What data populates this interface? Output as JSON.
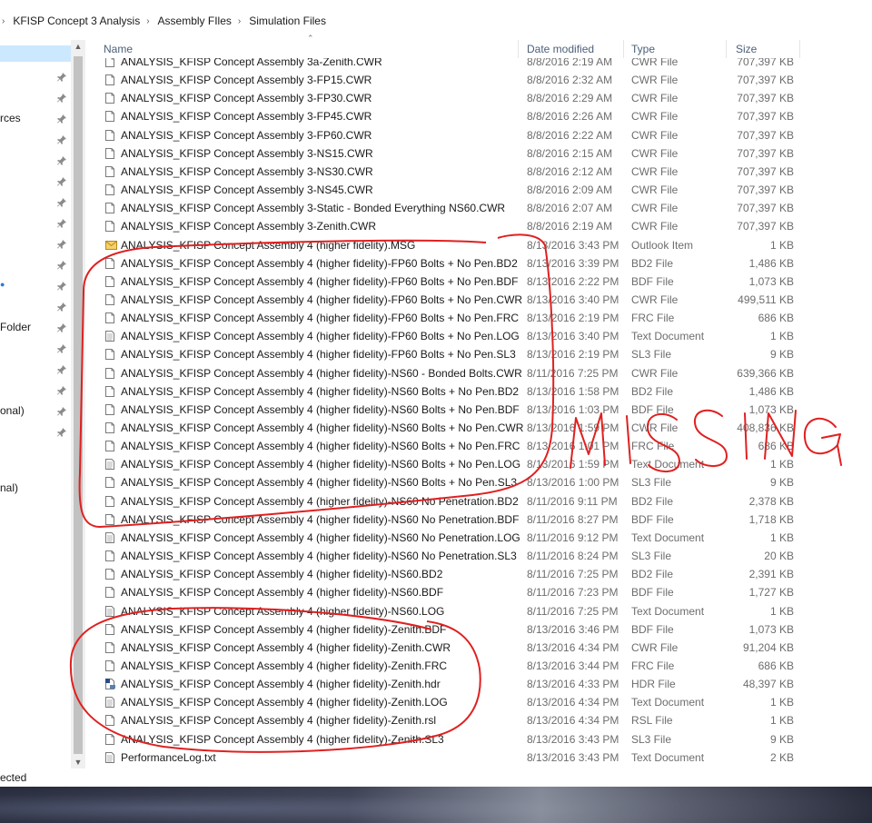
{
  "breadcrumb": [
    "KFISP Concept 3 Analysis",
    "Assembly FIles",
    "Simulation Files"
  ],
  "nav": {
    "labels": [
      "rces",
      "Folder",
      "onal)",
      "nal)"
    ]
  },
  "columns": {
    "name": "Name",
    "date": "Date modified",
    "type": "Type",
    "size": "Size"
  },
  "files": [
    {
      "name": "ANALYSIS_KFISP Concept Assembly 3a-Zenith.CWR",
      "date": "8/8/2016 2:19 AM",
      "type": "CWR File",
      "size": "707,397 KB",
      "icon": "file-icon"
    },
    {
      "name": "ANALYSIS_KFISP Concept Assembly 3-FP15.CWR",
      "date": "8/8/2016 2:32 AM",
      "type": "CWR File",
      "size": "707,397 KB",
      "icon": "file-icon"
    },
    {
      "name": "ANALYSIS_KFISP Concept Assembly 3-FP30.CWR",
      "date": "8/8/2016 2:29 AM",
      "type": "CWR File",
      "size": "707,397 KB",
      "icon": "file-icon"
    },
    {
      "name": "ANALYSIS_KFISP Concept Assembly 3-FP45.CWR",
      "date": "8/8/2016 2:26 AM",
      "type": "CWR File",
      "size": "707,397 KB",
      "icon": "file-icon"
    },
    {
      "name": "ANALYSIS_KFISP Concept Assembly 3-FP60.CWR",
      "date": "8/8/2016 2:22 AM",
      "type": "CWR File",
      "size": "707,397 KB",
      "icon": "file-icon"
    },
    {
      "name": "ANALYSIS_KFISP Concept Assembly 3-NS15.CWR",
      "date": "8/8/2016 2:15 AM",
      "type": "CWR File",
      "size": "707,397 KB",
      "icon": "file-icon"
    },
    {
      "name": "ANALYSIS_KFISP Concept Assembly 3-NS30.CWR",
      "date": "8/8/2016 2:12 AM",
      "type": "CWR File",
      "size": "707,397 KB",
      "icon": "file-icon"
    },
    {
      "name": "ANALYSIS_KFISP Concept Assembly 3-NS45.CWR",
      "date": "8/8/2016 2:09 AM",
      "type": "CWR File",
      "size": "707,397 KB",
      "icon": "file-icon"
    },
    {
      "name": "ANALYSIS_KFISP Concept Assembly 3-Static - Bonded Everything NS60.CWR",
      "date": "8/8/2016 2:07 AM",
      "type": "CWR File",
      "size": "707,397 KB",
      "icon": "file-icon"
    },
    {
      "name": "ANALYSIS_KFISP Concept Assembly 3-Zenith.CWR",
      "date": "8/8/2016 2:19 AM",
      "type": "CWR File",
      "size": "707,397 KB",
      "icon": "file-icon"
    },
    {
      "name": "ANALYSIS_KFISP Concept Assembly 4 (higher fidelity).MSG",
      "date": "8/13/2016 3:43 PM",
      "type": "Outlook Item",
      "size": "1 KB",
      "icon": "envelope-icon"
    },
    {
      "name": "ANALYSIS_KFISP Concept Assembly 4 (higher fidelity)-FP60 Bolts + No Pen.BD2",
      "date": "8/13/2016 3:39 PM",
      "type": "BD2 File",
      "size": "1,486 KB",
      "icon": "file-icon"
    },
    {
      "name": "ANALYSIS_KFISP Concept Assembly 4 (higher fidelity)-FP60 Bolts + No Pen.BDF",
      "date": "8/13/2016 2:22 PM",
      "type": "BDF File",
      "size": "1,073 KB",
      "icon": "file-icon"
    },
    {
      "name": "ANALYSIS_KFISP Concept Assembly 4 (higher fidelity)-FP60 Bolts + No Pen.CWR",
      "date": "8/13/2016 3:40 PM",
      "type": "CWR File",
      "size": "499,511 KB",
      "icon": "file-icon"
    },
    {
      "name": "ANALYSIS_KFISP Concept Assembly 4 (higher fidelity)-FP60 Bolts + No Pen.FRC",
      "date": "8/13/2016 2:19 PM",
      "type": "FRC File",
      "size": "686 KB",
      "icon": "file-icon"
    },
    {
      "name": "ANALYSIS_KFISP Concept Assembly 4 (higher fidelity)-FP60 Bolts + No Pen.LOG",
      "date": "8/13/2016 3:40 PM",
      "type": "Text Document",
      "size": "1 KB",
      "icon": "text-file-icon"
    },
    {
      "name": "ANALYSIS_KFISP Concept Assembly 4 (higher fidelity)-FP60 Bolts + No Pen.SL3",
      "date": "8/13/2016 2:19 PM",
      "type": "SL3 File",
      "size": "9 KB",
      "icon": "file-icon"
    },
    {
      "name": "ANALYSIS_KFISP Concept Assembly 4 (higher fidelity)-NS60 - Bonded Bolts.CWR",
      "date": "8/11/2016 7:25 PM",
      "type": "CWR File",
      "size": "639,366 KB",
      "icon": "file-icon"
    },
    {
      "name": "ANALYSIS_KFISP Concept Assembly 4 (higher fidelity)-NS60 Bolts + No Pen.BD2",
      "date": "8/13/2016 1:58 PM",
      "type": "BD2 File",
      "size": "1,486 KB",
      "icon": "file-icon"
    },
    {
      "name": "ANALYSIS_KFISP Concept Assembly 4 (higher fidelity)-NS60 Bolts + No Pen.BDF",
      "date": "8/13/2016 1:03 PM",
      "type": "BDF File",
      "size": "1,073 KB",
      "icon": "file-icon"
    },
    {
      "name": "ANALYSIS_KFISP Concept Assembly 4 (higher fidelity)-NS60 Bolts + No Pen.CWR",
      "date": "8/13/2016 1:59 PM",
      "type": "CWR File",
      "size": "408,836 KB",
      "icon": "file-icon"
    },
    {
      "name": "ANALYSIS_KFISP Concept Assembly 4 (higher fidelity)-NS60 Bolts + No Pen.FRC",
      "date": "8/13/2016 1:01 PM",
      "type": "FRC File",
      "size": "686 KB",
      "icon": "file-icon"
    },
    {
      "name": "ANALYSIS_KFISP Concept Assembly 4 (higher fidelity)-NS60 Bolts + No Pen.LOG",
      "date": "8/13/2016 1:59 PM",
      "type": "Text Document",
      "size": "1 KB",
      "icon": "text-file-icon"
    },
    {
      "name": "ANALYSIS_KFISP Concept Assembly 4 (higher fidelity)-NS60 Bolts + No Pen.SL3",
      "date": "8/13/2016 1:00 PM",
      "type": "SL3 File",
      "size": "9 KB",
      "icon": "file-icon"
    },
    {
      "name": "ANALYSIS_KFISP Concept Assembly 4 (higher fidelity)-NS60 No Penetration.BD2",
      "date": "8/11/2016 9:11 PM",
      "type": "BD2 File",
      "size": "2,378 KB",
      "icon": "file-icon"
    },
    {
      "name": "ANALYSIS_KFISP Concept Assembly 4 (higher fidelity)-NS60 No Penetration.BDF",
      "date": "8/11/2016 8:27 PM",
      "type": "BDF File",
      "size": "1,718 KB",
      "icon": "file-icon"
    },
    {
      "name": "ANALYSIS_KFISP Concept Assembly 4 (higher fidelity)-NS60 No Penetration.LOG",
      "date": "8/11/2016 9:12 PM",
      "type": "Text Document",
      "size": "1 KB",
      "icon": "text-file-icon"
    },
    {
      "name": "ANALYSIS_KFISP Concept Assembly 4 (higher fidelity)-NS60 No Penetration.SL3",
      "date": "8/11/2016 8:24 PM",
      "type": "SL3 File",
      "size": "20 KB",
      "icon": "file-icon"
    },
    {
      "name": "ANALYSIS_KFISP Concept Assembly 4 (higher fidelity)-NS60.BD2",
      "date": "8/11/2016 7:25 PM",
      "type": "BD2 File",
      "size": "2,391 KB",
      "icon": "file-icon"
    },
    {
      "name": "ANALYSIS_KFISP Concept Assembly 4 (higher fidelity)-NS60.BDF",
      "date": "8/11/2016 7:23 PM",
      "type": "BDF File",
      "size": "1,727 KB",
      "icon": "file-icon"
    },
    {
      "name": "ANALYSIS_KFISP Concept Assembly 4 (higher fidelity)-NS60.LOG",
      "date": "8/11/2016 7:25 PM",
      "type": "Text Document",
      "size": "1 KB",
      "icon": "text-file-icon"
    },
    {
      "name": "ANALYSIS_KFISP Concept Assembly 4 (higher fidelity)-Zenith.BDF",
      "date": "8/13/2016 3:46 PM",
      "type": "BDF File",
      "size": "1,073 KB",
      "icon": "file-icon"
    },
    {
      "name": "ANALYSIS_KFISP Concept Assembly 4 (higher fidelity)-Zenith.CWR",
      "date": "8/13/2016 4:34 PM",
      "type": "CWR File",
      "size": "91,204 KB",
      "icon": "file-icon"
    },
    {
      "name": "ANALYSIS_KFISP Concept Assembly 4 (higher fidelity)-Zenith.FRC",
      "date": "8/13/2016 3:44 PM",
      "type": "FRC File",
      "size": "686 KB",
      "icon": "file-icon"
    },
    {
      "name": "ANALYSIS_KFISP Concept Assembly 4 (higher fidelity)-Zenith.hdr",
      "date": "8/13/2016 4:33 PM",
      "type": "HDR File",
      "size": "48,397 KB",
      "icon": "hdr-file-icon"
    },
    {
      "name": "ANALYSIS_KFISP Concept Assembly 4 (higher fidelity)-Zenith.LOG",
      "date": "8/13/2016 4:34 PM",
      "type": "Text Document",
      "size": "1 KB",
      "icon": "text-file-icon"
    },
    {
      "name": "ANALYSIS_KFISP Concept Assembly 4 (higher fidelity)-Zenith.rsl",
      "date": "8/13/2016 4:34 PM",
      "type": "RSL File",
      "size": "1 KB",
      "icon": "file-icon"
    },
    {
      "name": "ANALYSIS_KFISP Concept Assembly 4 (higher fidelity)-Zenith.SL3",
      "date": "8/13/2016 3:43 PM",
      "type": "SL3 File",
      "size": "9 KB",
      "icon": "file-icon"
    },
    {
      "name": "PerformanceLog.txt",
      "date": "8/13/2016 3:43 PM",
      "type": "Text Document",
      "size": "2 KB",
      "icon": "text-file-icon"
    }
  ],
  "status": {
    "text": "ected"
  },
  "annotation": {
    "text": "MISSING",
    "color": "#e02020"
  }
}
